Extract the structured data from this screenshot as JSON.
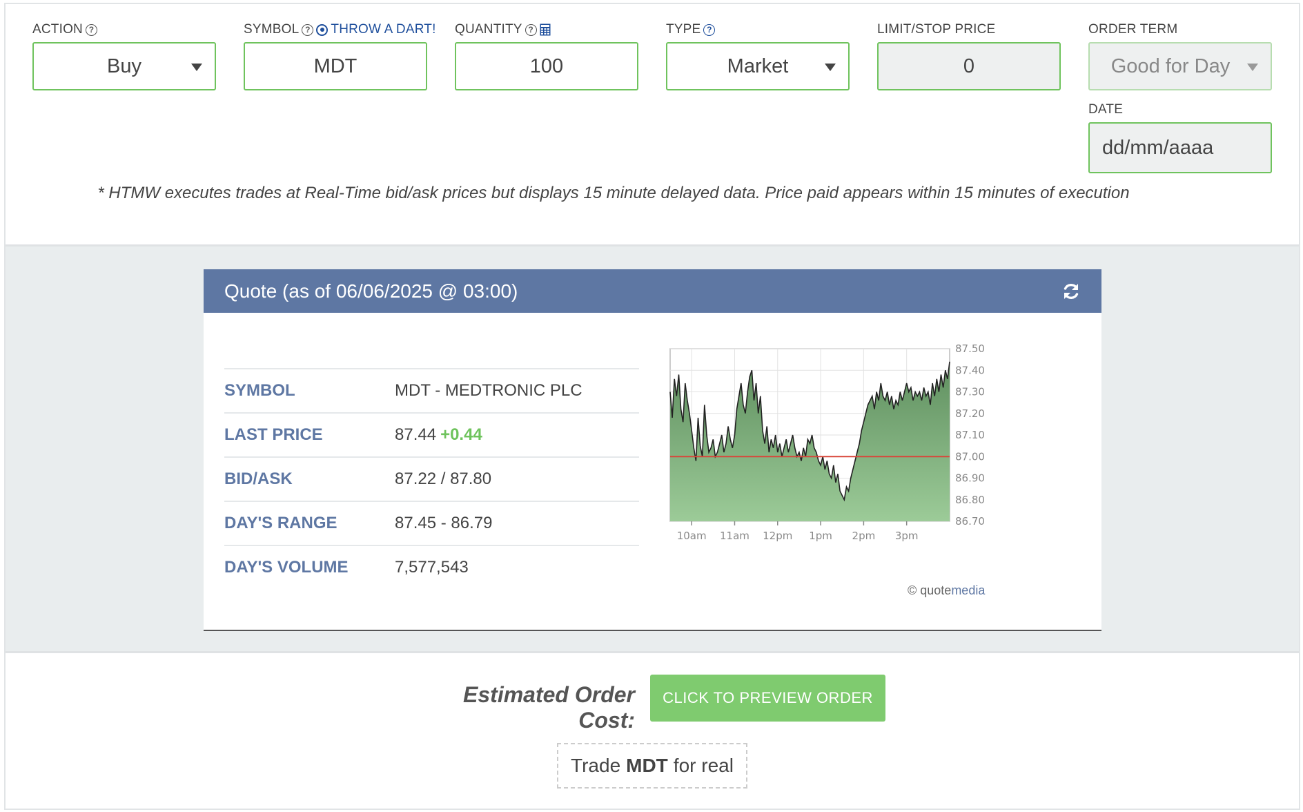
{
  "form": {
    "action": {
      "label": "ACTION",
      "value": "Buy"
    },
    "symbol": {
      "label": "SYMBOL",
      "value": "MDT",
      "dart_link": "THROW A DART!"
    },
    "quantity": {
      "label": "QUANTITY",
      "value": "100"
    },
    "type": {
      "label": "TYPE",
      "value": "Market"
    },
    "limit": {
      "label": "LIMIT/STOP PRICE",
      "value": "0"
    },
    "term": {
      "label": "ORDER TERM",
      "value": "Good for Day"
    },
    "date": {
      "label": "DATE",
      "placeholder": "dd/mm/aaaa"
    }
  },
  "disclaimer": "* HTMW executes trades at Real-Time bid/ask prices but displays 15 minute delayed data. Price paid appears within 15 minutes of execution",
  "quote": {
    "header": "Quote (as of 06/06/2025 @ 03:00)",
    "rows": [
      {
        "label": "SYMBOL",
        "value": "MDT - MEDTRONIC PLC"
      },
      {
        "label": "LAST PRICE",
        "value": "87.44",
        "change": "+0.44"
      },
      {
        "label": "BID/ASK",
        "value": "87.22 / 87.80"
      },
      {
        "label": "DAY'S RANGE",
        "value": "87.45 - 86.79"
      },
      {
        "label": "DAY'S VOLUME",
        "value": "7,577,543"
      }
    ],
    "credit_prefix": "© quote",
    "credit_suffix": "media"
  },
  "chart_data": {
    "type": "area",
    "x_ticks": [
      "10am",
      "11am",
      "12pm",
      "1pm",
      "2pm",
      "3pm"
    ],
    "y_ticks": [
      "87.50",
      "87.40",
      "87.30",
      "87.20",
      "87.10",
      "87.00",
      "86.90",
      "86.80",
      "86.70"
    ],
    "ylim": [
      86.7,
      87.5
    ],
    "reference_line": 87.0,
    "series": [
      {
        "x": [
          9.5,
          9.55,
          9.6,
          9.65,
          9.7,
          9.75,
          9.8,
          9.85,
          9.9,
          9.95,
          10.0,
          10.05,
          10.1,
          10.15,
          10.2,
          10.25,
          10.3,
          10.35,
          10.4,
          10.45,
          10.5,
          10.55,
          10.6,
          10.65,
          10.7,
          10.75,
          10.8,
          10.85,
          10.9,
          10.95,
          11.0,
          11.05,
          11.1,
          11.15,
          11.2,
          11.25,
          11.3,
          11.35,
          11.4,
          11.45,
          11.5,
          11.55,
          11.6,
          11.65,
          11.7,
          11.75,
          11.8,
          11.85,
          11.9,
          11.95,
          12.0,
          12.05,
          12.1,
          12.15,
          12.2,
          12.25,
          12.3,
          12.35,
          12.4,
          12.45,
          12.5,
          12.55,
          12.6,
          12.65,
          12.7,
          12.75,
          12.8,
          12.85,
          12.9,
          12.95,
          13.0,
          13.05,
          13.1,
          13.15,
          13.2,
          13.25,
          13.3,
          13.35,
          13.4,
          13.45,
          13.5,
          13.55,
          13.6,
          13.65,
          13.7,
          13.75,
          13.8,
          13.85,
          13.9,
          13.95,
          14.0,
          14.05,
          14.1,
          14.15,
          14.2,
          14.25,
          14.3,
          14.35,
          14.4,
          14.45,
          14.5,
          14.55,
          14.6,
          14.65,
          14.7,
          14.75,
          14.8,
          14.85,
          14.9,
          14.95,
          15.0,
          15.05,
          15.1,
          15.15,
          15.2,
          15.25,
          15.3,
          15.35,
          15.4,
          15.45,
          15.5,
          15.55,
          15.6,
          15.65,
          15.7,
          15.75,
          15.8,
          15.85,
          15.9,
          15.95,
          16.0
        ],
        "y": [
          87.3,
          87.18,
          87.36,
          87.28,
          87.38,
          87.22,
          87.16,
          87.34,
          87.26,
          87.2,
          87.12,
          87.04,
          86.98,
          87.18,
          87.05,
          87.0,
          87.24,
          87.1,
          87.02,
          87.04,
          87.08,
          87.0,
          87.02,
          87.06,
          87.1,
          87.02,
          87.06,
          87.14,
          87.08,
          87.04,
          87.1,
          87.22,
          87.28,
          87.34,
          87.24,
          87.2,
          87.3,
          87.37,
          87.4,
          87.26,
          87.34,
          87.2,
          87.28,
          87.12,
          87.06,
          87.14,
          87.02,
          87.08,
          87.04,
          87.1,
          87.02,
          87.06,
          87.0,
          87.04,
          87.08,
          87.02,
          87.06,
          87.1,
          87.04,
          87.0,
          87.02,
          86.98,
          87.04,
          87.0,
          87.08,
          87.06,
          87.1,
          87.04,
          87.02,
          86.98,
          86.96,
          87.0,
          86.94,
          86.98,
          86.92,
          86.9,
          86.96,
          86.88,
          86.92,
          86.84,
          86.82,
          86.8,
          86.86,
          86.84,
          86.9,
          86.94,
          86.98,
          87.02,
          87.06,
          87.12,
          87.16,
          87.2,
          87.24,
          87.26,
          87.28,
          87.22,
          87.3,
          87.26,
          87.34,
          87.28,
          87.26,
          87.3,
          87.24,
          87.28,
          87.22,
          87.26,
          87.24,
          87.3,
          87.26,
          87.3,
          87.34,
          87.3,
          87.32,
          87.26,
          87.3,
          87.28,
          87.3,
          87.26,
          87.32,
          87.28,
          87.3,
          87.24,
          87.34,
          87.28,
          87.36,
          87.3,
          87.38,
          87.32,
          87.4,
          87.36,
          87.44
        ]
      }
    ]
  },
  "footer": {
    "est_label": "Estimated Order Cost:",
    "preview_button": "CLICK TO PREVIEW ORDER",
    "trade_prefix": "Trade",
    "trade_symbol": "MDT",
    "trade_suffix": "for real"
  },
  "colors": {
    "field_border": "#6fc35d",
    "header_blue": "#5e77a3",
    "button_green": "#7fcb6f",
    "area_green": "#6b9a6b",
    "reference_line": "#d9463a"
  }
}
